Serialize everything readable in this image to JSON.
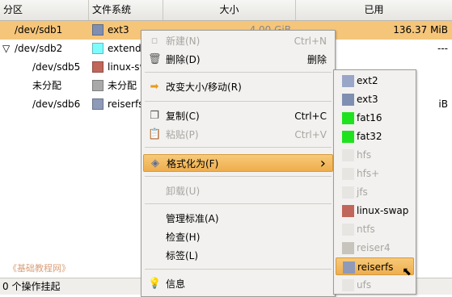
{
  "columns": {
    "partition": "分区",
    "filesystem": "文件系统",
    "size": "大小",
    "used": "已用"
  },
  "rows": [
    {
      "expander": "",
      "name": "/dev/sdb1",
      "fs": "ext3",
      "fs_color": "#7f8fb2",
      "size": "4.00 GiB",
      "used": "136.37 MiB",
      "selected": true
    },
    {
      "expander": "▽",
      "name": "/dev/sdb2",
      "fs": "extended",
      "fs_color": "#7dfcfe",
      "size": "",
      "used": "---",
      "selected": false
    },
    {
      "expander": "",
      "name": "/dev/sdb5",
      "fs": "linux-swap",
      "fs_color": "#c1665a",
      "size": "",
      "used": "",
      "selected": false
    },
    {
      "expander": "",
      "name": "未分配",
      "fs": "未分配",
      "fs_color": "#a9a9a9",
      "size": "",
      "used": "",
      "selected": false
    },
    {
      "expander": "",
      "name": "/dev/sdb6",
      "fs": "reiserfs",
      "fs_color": "#8e9ab8",
      "size": "",
      "used": "iB",
      "selected": false
    }
  ],
  "status": "0 个操作挂起",
  "watermark": "《基础教程网》",
  "context_menu": {
    "items": [
      {
        "label": "新建(N)",
        "accel": "Ctrl+N",
        "icon": "new-icon",
        "disabled": true
      },
      {
        "label": "删除(D)",
        "accel": "删除",
        "icon": "delete-icon",
        "disabled": false
      },
      {
        "label": "改变大小/移动(R)",
        "accel": "",
        "icon": "resize-arrow-icon",
        "disabled": false
      },
      {
        "label": "复制(C)",
        "accel": "Ctrl+C",
        "icon": "copy-icon",
        "disabled": false
      },
      {
        "label": "粘贴(P)",
        "accel": "Ctrl+V",
        "icon": "paste-icon",
        "disabled": true
      },
      {
        "label": "格式化为(F)",
        "accel": "",
        "icon": "format-icon",
        "disabled": false,
        "submenu": true
      },
      {
        "label": "卸载(U)",
        "accel": "",
        "icon": "",
        "disabled": true
      },
      {
        "label": "管理标准(A)",
        "accel": "",
        "icon": "",
        "disabled": false
      },
      {
        "label": "检查(H)",
        "accel": "",
        "icon": "",
        "disabled": false
      },
      {
        "label": "标签(L)",
        "accel": "",
        "icon": "",
        "disabled": false
      },
      {
        "label": "信息",
        "accel": "",
        "icon": "info-bulb-icon",
        "disabled": false
      }
    ]
  },
  "format_submenu": {
    "items": [
      {
        "label": "ext2",
        "color": "#9aa6c8",
        "disabled": false
      },
      {
        "label": "ext3",
        "color": "#7f8fb2",
        "disabled": false
      },
      {
        "label": "fat16",
        "color": "#1fe21f",
        "disabled": false
      },
      {
        "label": "fat32",
        "color": "#1fe21f",
        "disabled": false
      },
      {
        "label": "hfs",
        "color": "#e6e5e2",
        "disabled": true
      },
      {
        "label": "hfs+",
        "color": "#e6e5e2",
        "disabled": true
      },
      {
        "label": "jfs",
        "color": "#e6e5e2",
        "disabled": true
      },
      {
        "label": "linux-swap",
        "color": "#c1665a",
        "disabled": false
      },
      {
        "label": "ntfs",
        "color": "#e6e5e2",
        "disabled": true
      },
      {
        "label": "reiser4",
        "color": "#c7c4bd",
        "disabled": true
      },
      {
        "label": "reiserfs",
        "color": "#8e9ab8",
        "disabled": false,
        "active": true
      },
      {
        "label": "ufs",
        "color": "#e6e5e2",
        "disabled": true
      }
    ]
  }
}
